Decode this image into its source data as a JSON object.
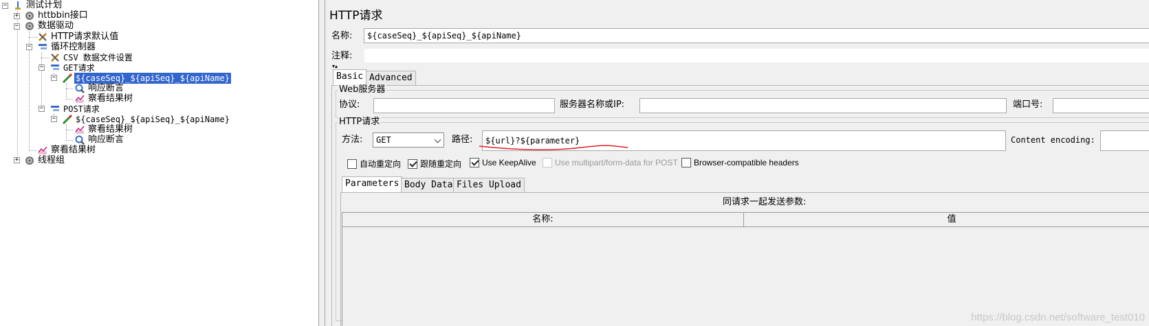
{
  "tree": {
    "items": [
      {
        "label": "测试计划",
        "icon": "test-plan-icon"
      },
      {
        "label": "httbbin接口",
        "icon": "gear-icon"
      },
      {
        "label": "数据驱动",
        "icon": "gear-icon"
      },
      {
        "label": "HTTP请求默认值",
        "icon": "wrench-icon"
      },
      {
        "label": "循环控制器",
        "icon": "controller-icon"
      },
      {
        "label": "CSV 数据文件设置",
        "icon": "wrench-icon"
      },
      {
        "label": "GET请求",
        "icon": "controller-icon"
      },
      {
        "label": "${caseSeq}_${apiSeq}_${apiName}",
        "icon": "sampler-pen-icon"
      },
      {
        "label": "响应断言",
        "icon": "magnifier-icon"
      },
      {
        "label": "察看结果树",
        "icon": "chart-icon"
      },
      {
        "label": "POST请求",
        "icon": "controller-icon"
      },
      {
        "label": "${caseSeq}_${apiSeq}_${apiName}",
        "icon": "sampler-pen-icon"
      },
      {
        "label": "察看结果树",
        "icon": "chart-icon"
      },
      {
        "label": "响应断言",
        "icon": "magnifier-icon"
      },
      {
        "label": "察看结果树",
        "icon": "chart-icon"
      },
      {
        "label": "线程组",
        "icon": "gear-icon"
      }
    ],
    "expander_collapsed": "+",
    "expander_expanded": "−"
  },
  "panel": {
    "title": "HTTP请求",
    "name_label": "名称:",
    "name_value": "${caseSeq}_${apiSeq}_${apiName}",
    "comment_label": "注释:",
    "comment_value": "",
    "tabs": [
      "Basic",
      "Advanced"
    ],
    "web_server": {
      "group_title": "Web服务器",
      "protocol_label": "协议:",
      "protocol_value": "",
      "server_label": "服务器名称或IP:",
      "server_value": "",
      "port_label": "端口号:",
      "port_value": ""
    },
    "http_request": {
      "group_title": "HTTP请求",
      "method_label": "方法:",
      "method_value": "GET",
      "path_label": "路径:",
      "path_value": "${url}?${parameter}",
      "encoding_label": "Content encoding:"
    },
    "options": [
      {
        "label": "自动重定向",
        "checked": false,
        "disabled": false
      },
      {
        "label": "跟随重定向",
        "checked": true,
        "disabled": false
      },
      {
        "label": "Use KeepAlive",
        "checked": true,
        "disabled": false
      },
      {
        "label": "Use multipart/form-data for POST",
        "checked": false,
        "disabled": true
      },
      {
        "label": "Browser-compatible headers",
        "checked": false,
        "disabled": false
      }
    ],
    "sub_tabs": [
      "Parameters",
      "Body Data",
      "Files Upload"
    ],
    "params_caption": "同请求一起发送参数:",
    "columns": [
      "名称:",
      "值"
    ]
  },
  "watermark": "https://blog.csdn.net/software_test010",
  "colors": {
    "selection": "#3366cc",
    "annotation_underline": "#e02020"
  }
}
